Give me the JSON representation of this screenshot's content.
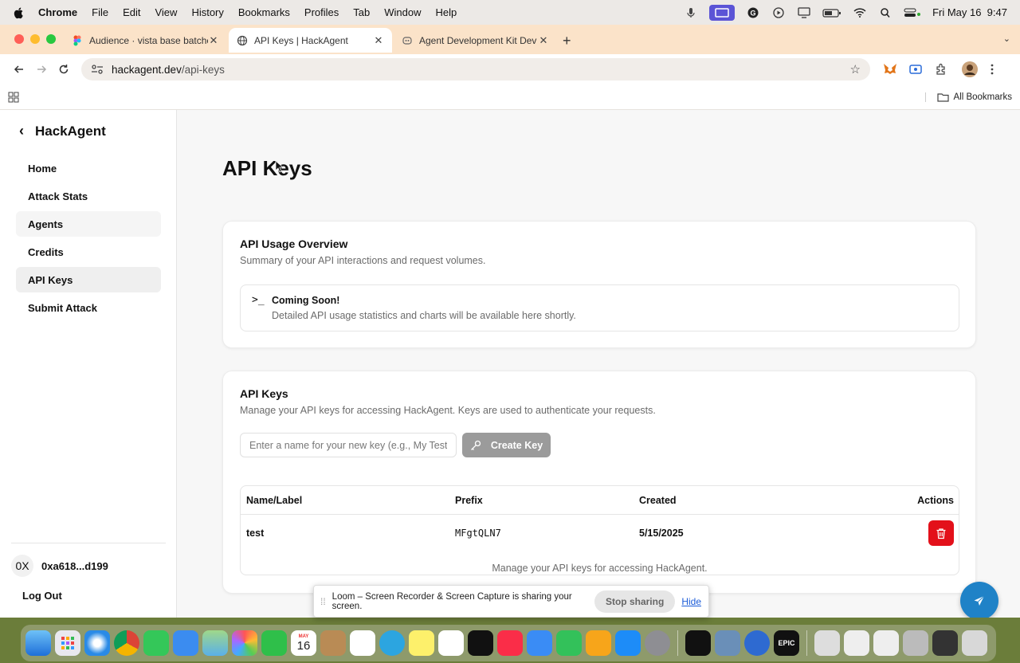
{
  "menubar": {
    "app": "Chrome",
    "items": [
      "File",
      "Edit",
      "View",
      "History",
      "Bookmarks",
      "Profiles",
      "Tab",
      "Window",
      "Help"
    ],
    "clock": "Fri May 16  9:47"
  },
  "browser": {
    "tabs": [
      {
        "title": "Audience · vista base batche",
        "icon": "figma-icon"
      },
      {
        "title": "API Keys | HackAgent",
        "icon": "globe-icon"
      },
      {
        "title": "Agent Development Kit Dev U",
        "icon": "adk-icon"
      }
    ],
    "url_host": "hackagent.dev",
    "url_path": "/api-keys",
    "bookmarks_all": "All Bookmarks"
  },
  "sidebar": {
    "brand": "HackAgent",
    "items": [
      {
        "label": "Home"
      },
      {
        "label": "Attack Stats"
      },
      {
        "label": "Agents"
      },
      {
        "label": "Credits"
      },
      {
        "label": "API Keys"
      },
      {
        "label": "Submit Attack"
      }
    ],
    "avatar_text": "0X",
    "account": "0xa618...d199",
    "logout": "Log Out"
  },
  "main": {
    "title": "API Keys",
    "usage": {
      "title": "API Usage Overview",
      "subtitle": "Summary of your API interactions and request volumes.",
      "notice_title": "Coming Soon!",
      "notice_desc": "Detailed API usage statistics and charts will be available here shortly."
    },
    "keys": {
      "title": "API Keys",
      "subtitle": "Manage your API keys for accessing HackAgent. Keys are used to authenticate your requests.",
      "input_placeholder": "Enter a name for your new key (e.g., My Test",
      "create_label": "Create Key",
      "columns": [
        "Name/Label",
        "Prefix",
        "Created",
        "Actions"
      ],
      "rows": [
        {
          "name": "test",
          "prefix": "MFgtQLN7",
          "created": "5/15/2025"
        }
      ],
      "caption": "Manage your API keys for accessing HackAgent."
    }
  },
  "loom": {
    "message": "Loom – Screen Recorder & Screen Capture is sharing your screen.",
    "stop": "Stop sharing",
    "hide": "Hide"
  },
  "dock": {
    "calendar_month": "MAY",
    "calendar_day": "16",
    "epic_label": "EPIC"
  },
  "colors": {
    "tabstrip": "#fbe3c9",
    "delete": "#e3101a",
    "fab": "#1f82c7",
    "create_button": "#9b9b9b"
  }
}
